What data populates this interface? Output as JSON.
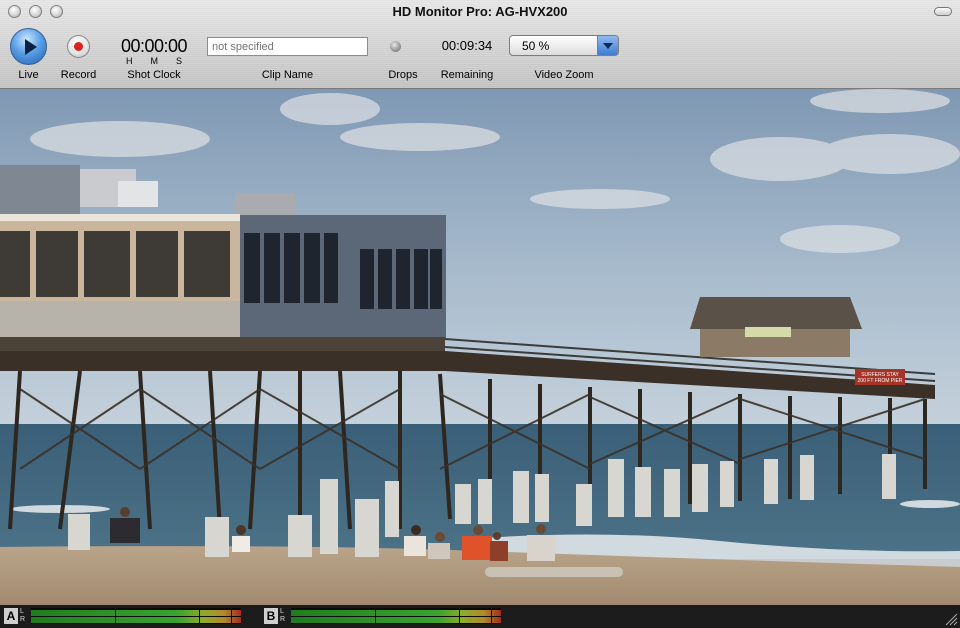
{
  "window": {
    "title": "HD Monitor Pro: AG-HVX200"
  },
  "toolbar": {
    "live_label": "Live",
    "record_label": "Record",
    "shot_clock": "00:00:00",
    "shot_clock_units": [
      "H",
      "M",
      "S"
    ],
    "shot_clock_label": "Shot Clock",
    "clip_name_placeholder": "not specified",
    "clip_name_label": "Clip Name",
    "drops_label": "Drops",
    "remaining_value": "00:09:34",
    "remaining_label": "Remaining",
    "zoom_value": "50 %",
    "zoom_label": "Video Zoom"
  },
  "video": {
    "sign_text_1": "SURFERS STAY",
    "sign_text_2": "200 FT FROM PIER"
  },
  "audio": {
    "channel_a": "A",
    "channel_b": "B",
    "channel_sub": [
      "L",
      "R"
    ]
  },
  "colors": {
    "record_dot": "#e02020",
    "play_button": "#3a86d8",
    "meter_green": "#39a52f",
    "meter_red": "#a62a20"
  },
  "icons": {
    "play": "play-icon",
    "record": "record-icon",
    "drops": "drops-indicator-icon",
    "dropdown": "chevron-down-icon"
  }
}
